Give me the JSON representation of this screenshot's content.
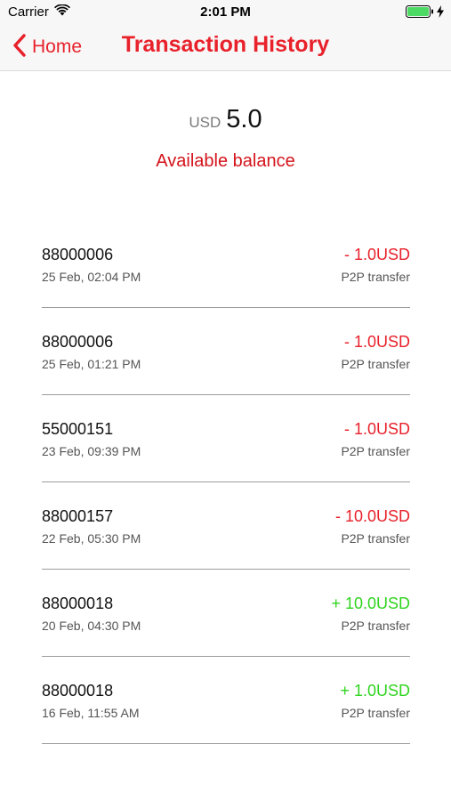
{
  "status_bar": {
    "carrier": "Carrier",
    "time": "2:01 PM",
    "battery_level": 1.0
  },
  "nav": {
    "back_label": "Home",
    "title": "Transaction History"
  },
  "balance": {
    "currency": "USD",
    "amount": "5.0",
    "label": "Available balance"
  },
  "colors": {
    "accent_red": "#e8212b",
    "credit_green": "#2fd41f"
  },
  "transactions": [
    {
      "account": "88000006",
      "date": "25 Feb, 02:04 PM",
      "amount": "- 1.0USD",
      "type": "P2P transfer",
      "direction": "debit"
    },
    {
      "account": "88000006",
      "date": "25 Feb, 01:21 PM",
      "amount": "- 1.0USD",
      "type": "P2P transfer",
      "direction": "debit"
    },
    {
      "account": "55000151",
      "date": "23 Feb, 09:39 PM",
      "amount": "- 1.0USD",
      "type": "P2P transfer",
      "direction": "debit"
    },
    {
      "account": "88000157",
      "date": "22 Feb, 05:30 PM",
      "amount": "- 10.0USD",
      "type": "P2P transfer",
      "direction": "debit"
    },
    {
      "account": "88000018",
      "date": "20 Feb, 04:30 PM",
      "amount": "+ 10.0USD",
      "type": "P2P transfer",
      "direction": "credit"
    },
    {
      "account": "88000018",
      "date": "16 Feb, 11:55 AM",
      "amount": "+ 1.0USD",
      "type": "P2P transfer",
      "direction": "credit"
    }
  ]
}
